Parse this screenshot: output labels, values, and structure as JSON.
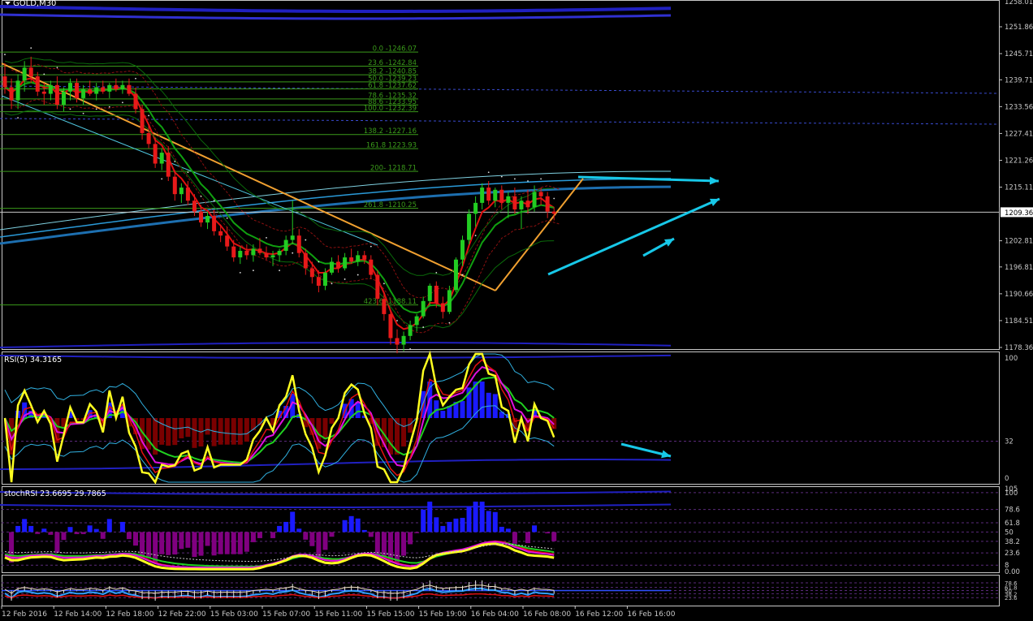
{
  "window": {
    "title": "GOLD,M30",
    "menu_icon": "triangle-down-icon"
  },
  "colors": {
    "background": "#000000",
    "bull_candle": "#22cc22",
    "bear_candle": "#e81a1a",
    "fibo": "#3a9a1a",
    "trendline": "#f0a030",
    "arrow": "#17c8e8",
    "ma_red": "#e01010",
    "ma_green": "#10a010",
    "rsi_yellow": "#ffff20",
    "hist_blue": "#1a1aff",
    "hist_maroon": "#7a0000",
    "hist_purple": "#800080",
    "envelope_blue": "#2020c0"
  },
  "price_axis": {
    "labels": [
      "1251.86",
      "1245.71",
      "1239.71",
      "1233.56",
      "1227.41",
      "1221.26",
      "1215.11",
      "1209.36",
      "1202.81",
      "1196.81",
      "1190.66",
      "1184.51",
      "1178.36"
    ],
    "current_price": "1209.36",
    "top_partial": "1258.01"
  },
  "time_axis": {
    "labels": [
      "12 Feb 2016",
      "12 Feb 14:00",
      "12 Feb 18:00",
      "12 Feb 22:00",
      "15 Feb 03:00",
      "15 Feb 07:00",
      "15 Feb 11:00",
      "15 Feb 15:00",
      "15 Feb 19:00",
      "16 Feb 04:00",
      "16 Feb 08:00",
      "16 Feb 12:00",
      "16 Feb 16:00"
    ]
  },
  "fibo_levels": [
    {
      "label": "0.0 -1246.07"
    },
    {
      "label": "23.6 -1242.84"
    },
    {
      "label": "38.2 -1240.85"
    },
    {
      "label": "50.0 -1239.23"
    },
    {
      "label": "61.8 -1237.62"
    },
    {
      "label": "78.6 -1235.32"
    },
    {
      "label": "88.6 -1233.95"
    },
    {
      "label": "100.0 -1232.39"
    },
    {
      "label": "138.2 -1227.16"
    },
    {
      "label": "161.8 1223.93"
    },
    {
      "label": "200- 1218.71"
    },
    {
      "label": "261.8 -1210.25"
    },
    {
      "label": "423.6 -1188.11"
    }
  ],
  "rsi_panel": {
    "title": "RSI(5) 34.3165",
    "axis": [
      "100",
      "32",
      "0"
    ]
  },
  "stoch_panel": {
    "title": "stochRSI 23.6695 29.7865",
    "axis": [
      "105",
      "100",
      "78.6",
      "61.8",
      "50",
      "38.2",
      "23.6",
      "8",
      "0.00"
    ]
  },
  "bottom_panel": {
    "axis": [
      "78.6",
      "61.8",
      "50",
      "38.2",
      "23.6"
    ]
  },
  "chart_data": {
    "type": "candlestick",
    "symbol": "GOLD",
    "timeframe": "M30",
    "ylim": [
      1178.36,
      1258.01
    ],
    "candles": [
      [
        1240.5,
        1243.5,
        1236.5,
        1238.0
      ],
      [
        1238.0,
        1240.0,
        1233.0,
        1235.0
      ],
      [
        1235.0,
        1241.0,
        1233.0,
        1239.5
      ],
      [
        1239.5,
        1244.0,
        1237.0,
        1242.5
      ],
      [
        1242.5,
        1245.0,
        1239.0,
        1240.5
      ],
      [
        1240.5,
        1241.5,
        1236.0,
        1237.0
      ],
      [
        1237.0,
        1239.0,
        1234.0,
        1236.5
      ],
      [
        1236.5,
        1239.5,
        1235.0,
        1238.5
      ],
      [
        1238.5,
        1240.5,
        1233.0,
        1234.0
      ],
      [
        1234.0,
        1238.0,
        1232.5,
        1237.0
      ],
      [
        1237.0,
        1240.0,
        1235.0,
        1239.0
      ],
      [
        1239.0,
        1240.0,
        1234.5,
        1235.5
      ],
      [
        1235.5,
        1238.5,
        1234.0,
        1237.5
      ],
      [
        1237.5,
        1239.5,
        1236.0,
        1236.5
      ],
      [
        1236.5,
        1239.0,
        1235.0,
        1238.0
      ],
      [
        1238.0,
        1239.5,
        1236.5,
        1237.0
      ],
      [
        1237.0,
        1239.0,
        1235.5,
        1238.5
      ],
      [
        1238.5,
        1240.0,
        1237.0,
        1237.5
      ],
      [
        1237.5,
        1239.5,
        1236.5,
        1238.5
      ],
      [
        1238.5,
        1240.0,
        1236.0,
        1236.5
      ],
      [
        1236.5,
        1238.0,
        1232.0,
        1233.0
      ],
      [
        1233.0,
        1234.0,
        1226.0,
        1227.5
      ],
      [
        1227.5,
        1229.5,
        1224.0,
        1225.0
      ],
      [
        1225.0,
        1226.5,
        1219.5,
        1220.5
      ],
      [
        1220.5,
        1224.0,
        1219.0,
        1223.0
      ],
      [
        1223.0,
        1224.5,
        1216.5,
        1217.5
      ],
      [
        1217.5,
        1219.0,
        1212.0,
        1213.5
      ],
      [
        1213.5,
        1216.0,
        1211.5,
        1215.0
      ],
      [
        1215.0,
        1216.5,
        1211.0,
        1212.0
      ],
      [
        1212.0,
        1213.5,
        1208.5,
        1209.5
      ],
      [
        1209.5,
        1211.0,
        1206.0,
        1207.0
      ],
      [
        1207.0,
        1209.5,
        1205.5,
        1208.5
      ],
      [
        1208.5,
        1210.0,
        1204.0,
        1205.0
      ],
      [
        1205.0,
        1206.5,
        1202.5,
        1204.0
      ],
      [
        1204.0,
        1206.0,
        1200.5,
        1201.5
      ],
      [
        1201.5,
        1203.0,
        1198.0,
        1199.0
      ],
      [
        1199.0,
        1201.5,
        1197.5,
        1200.5
      ],
      [
        1200.5,
        1202.0,
        1198.5,
        1199.5
      ],
      [
        1199.5,
        1202.0,
        1198.0,
        1201.0
      ],
      [
        1201.0,
        1203.5,
        1199.5,
        1200.0
      ],
      [
        1200.0,
        1201.5,
        1198.5,
        1199.0
      ],
      [
        1199.0,
        1200.5,
        1197.0,
        1199.5
      ],
      [
        1199.5,
        1201.0,
        1198.0,
        1200.5
      ],
      [
        1200.5,
        1204.0,
        1199.5,
        1203.0
      ],
      [
        1203.0,
        1212.0,
        1202.0,
        1204.0
      ],
      [
        1204.0,
        1205.5,
        1199.0,
        1200.0
      ],
      [
        1200.0,
        1201.0,
        1195.0,
        1196.5
      ],
      [
        1196.5,
        1198.0,
        1193.0,
        1194.5
      ],
      [
        1194.5,
        1196.0,
        1191.0,
        1192.5
      ],
      [
        1192.5,
        1196.5,
        1191.5,
        1195.5
      ],
      [
        1195.5,
        1199.0,
        1195.0,
        1198.0
      ],
      [
        1198.0,
        1199.5,
        1195.5,
        1196.5
      ],
      [
        1196.5,
        1200.0,
        1196.0,
        1199.0
      ],
      [
        1199.0,
        1201.0,
        1197.5,
        1198.0
      ],
      [
        1198.0,
        1200.5,
        1197.0,
        1199.5
      ],
      [
        1199.5,
        1200.5,
        1197.5,
        1198.5
      ],
      [
        1198.5,
        1199.5,
        1194.0,
        1195.0
      ],
      [
        1195.0,
        1196.0,
        1188.0,
        1189.5
      ],
      [
        1189.5,
        1191.0,
        1184.5,
        1186.0
      ],
      [
        1186.0,
        1187.0,
        1179.0,
        1180.5
      ],
      [
        1180.5,
        1182.5,
        1177.0,
        1179.0
      ],
      [
        1179.0,
        1182.0,
        1177.5,
        1181.0
      ],
      [
        1181.0,
        1184.5,
        1180.0,
        1183.5
      ],
      [
        1183.5,
        1186.0,
        1182.0,
        1185.5
      ],
      [
        1185.5,
        1190.0,
        1185.0,
        1189.0
      ],
      [
        1189.0,
        1193.0,
        1188.0,
        1192.5
      ],
      [
        1192.5,
        1193.5,
        1187.5,
        1188.5
      ],
      [
        1188.5,
        1190.0,
        1185.0,
        1186.5
      ],
      [
        1186.5,
        1192.5,
        1186.0,
        1191.5
      ],
      [
        1191.5,
        1199.0,
        1191.0,
        1198.5
      ],
      [
        1198.5,
        1204.0,
        1197.0,
        1203.0
      ],
      [
        1203.0,
        1210.0,
        1202.0,
        1209.0
      ],
      [
        1209.0,
        1213.0,
        1206.0,
        1211.5
      ],
      [
        1211.5,
        1216.0,
        1210.0,
        1215.0
      ],
      [
        1215.0,
        1216.5,
        1211.0,
        1212.0
      ],
      [
        1212.0,
        1215.0,
        1210.5,
        1214.5
      ],
      [
        1214.5,
        1215.5,
        1210.0,
        1211.5
      ],
      [
        1211.5,
        1214.0,
        1208.0,
        1213.0
      ],
      [
        1213.0,
        1215.0,
        1209.0,
        1210.0
      ],
      [
        1210.0,
        1213.0,
        1205.5,
        1212.0
      ],
      [
        1212.0,
        1214.5,
        1209.0,
        1210.5
      ],
      [
        1210.5,
        1215.5,
        1209.5,
        1214.0
      ],
      [
        1214.0,
        1215.0,
        1211.0,
        1213.0
      ],
      [
        1213.0,
        1214.0,
        1208.0,
        1209.5
      ],
      [
        1209.5,
        1210.5,
        1207.5,
        1209.0
      ]
    ],
    "current_price": 1209.36,
    "x_labels": [
      "12 Feb 2016",
      "12 Feb 14:00",
      "12 Feb 18:00",
      "12 Feb 22:00",
      "15 Feb 03:00",
      "15 Feb 07:00",
      "15 Feb 11:00",
      "15 Feb 15:00",
      "15 Feb 19:00",
      "16 Feb 04:00",
      "16 Feb 08:00",
      "16 Feb 12:00",
      "16 Feb 16:00"
    ],
    "fibo": [
      {
        "ratio": 0.0,
        "price": 1246.07
      },
      {
        "ratio": 23.6,
        "price": 1242.84
      },
      {
        "ratio": 38.2,
        "price": 1240.85
      },
      {
        "ratio": 50.0,
        "price": 1239.23
      },
      {
        "ratio": 61.8,
        "price": 1237.62
      },
      {
        "ratio": 78.6,
        "price": 1235.32
      },
      {
        "ratio": 88.6,
        "price": 1233.95
      },
      {
        "ratio": 100.0,
        "price": 1232.39
      },
      {
        "ratio": 138.2,
        "price": 1227.16
      },
      {
        "ratio": 161.8,
        "price": 1223.93
      },
      {
        "ratio": 200,
        "price": 1218.71
      },
      {
        "ratio": 261.8,
        "price": 1210.25
      },
      {
        "ratio": 423.6,
        "price": 1188.11
      }
    ],
    "rsi": {
      "value": 34.3165,
      "ylim": [
        0,
        100
      ],
      "level": 32
    },
    "stoch_rsi": {
      "values": [
        23.6695,
        29.7865
      ],
      "ylim": [
        0,
        105
      ],
      "levels": [
        100,
        78.6,
        61.8,
        50,
        38.2,
        23.6,
        8
      ]
    },
    "grid": false
  }
}
